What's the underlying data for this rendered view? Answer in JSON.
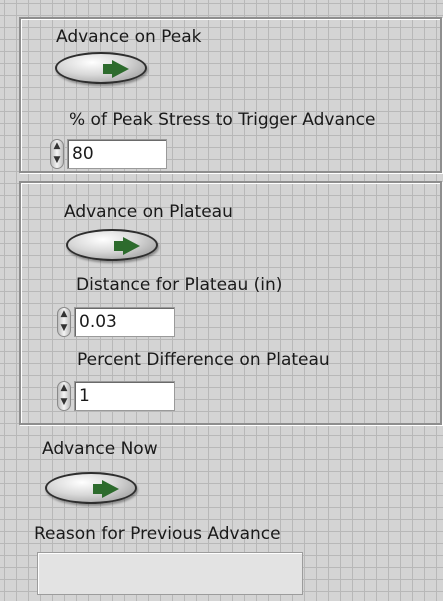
{
  "peak_group": {
    "advance_label": "Advance on Peak",
    "trigger_label": "% of Peak Stress to Trigger Advance",
    "trigger_value": "80"
  },
  "plateau_group": {
    "advance_label": "Advance on Plateau",
    "distance_label": "Distance for Plateau (in)",
    "distance_value": "0.03",
    "percent_label": "Percent Difference on Plateau",
    "percent_value": "1"
  },
  "advance_now": {
    "label": "Advance Now"
  },
  "reason": {
    "label": "Reason for Previous Advance",
    "value": ""
  },
  "icons": {
    "toggle_indicator": "green-right-arrow-icon",
    "spinner": "up-down-arrows-icon"
  },
  "colors": {
    "panel_background": "#d4d4d4",
    "grid_lines": "#b8b8b8",
    "indicator_green": "#2d6b2d"
  }
}
